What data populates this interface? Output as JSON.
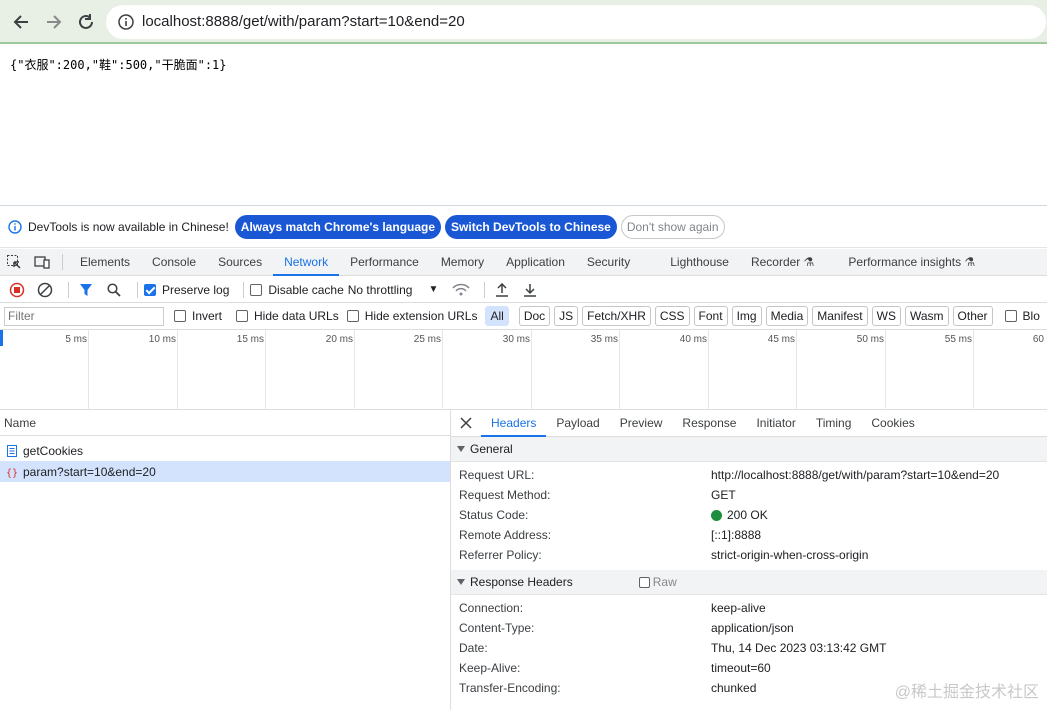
{
  "browser": {
    "url": "localhost:8888/get/with/param?start=10&end=20",
    "icons": [
      "back-arrow-icon",
      "forward-arrow-icon",
      "reload-icon",
      "site-info-icon"
    ]
  },
  "page": {
    "response_text": "{\"衣服\":200,\"鞋\":500,\"干脆面\":1}"
  },
  "infobar": {
    "message": "DevTools is now available in Chinese!",
    "btn_match": "Always match Chrome's language",
    "btn_switch": "Switch DevTools to Chinese",
    "btn_dont_show": "Don't show again"
  },
  "tabs": {
    "elements": "Elements",
    "console": "Console",
    "sources": "Sources",
    "network": "Network",
    "performance": "Performance",
    "memory": "Memory",
    "application": "Application",
    "security": "Security",
    "lighthouse": "Lighthouse",
    "recorder": "Recorder",
    "perf_insights": "Performance insights"
  },
  "toolbar": {
    "preserve_log": "Preserve log",
    "preserve_log_checked": true,
    "disable_cache": "Disable cache",
    "disable_cache_checked": false,
    "throttling": "No throttling"
  },
  "filterbar": {
    "placeholder": "Filter",
    "invert": "Invert",
    "hide_data_urls": "Hide data URLs",
    "hide_ext_urls": "Hide extension URLs",
    "types": [
      "All",
      "Doc",
      "JS",
      "Fetch/XHR",
      "CSS",
      "Font",
      "Img",
      "Media",
      "Manifest",
      "WS",
      "Wasm",
      "Other"
    ],
    "selected_type": "All",
    "blocked_prefix": "Blo"
  },
  "timeline": {
    "ticks": [
      "5 ms",
      "10 ms",
      "15 ms",
      "20 ms",
      "25 ms",
      "30 ms",
      "35 ms",
      "40 ms",
      "45 ms",
      "50 ms",
      "55 ms",
      "60"
    ]
  },
  "requests": {
    "header": "Name",
    "rows": [
      {
        "name": "getCookies",
        "selected": false
      },
      {
        "name": "param?start=10&end=20",
        "selected": true
      }
    ]
  },
  "details": {
    "tabs": [
      "Headers",
      "Payload",
      "Preview",
      "Response",
      "Initiator",
      "Timing",
      "Cookies"
    ],
    "general": {
      "title": "General",
      "rows": [
        {
          "k": "Request URL:",
          "v": "http://localhost:8888/get/with/param?start=10&end=20"
        },
        {
          "k": "Request Method:",
          "v": "GET"
        },
        {
          "k": "Status Code:",
          "v": "200 OK"
        },
        {
          "k": "Remote Address:",
          "v": "[::1]:8888"
        },
        {
          "k": "Referrer Policy:",
          "v": "strict-origin-when-cross-origin"
        }
      ]
    },
    "response_headers": {
      "title": "Response Headers",
      "raw_label": "Raw",
      "rows": [
        {
          "k": "Connection:",
          "v": "keep-alive"
        },
        {
          "k": "Content-Type:",
          "v": "application/json"
        },
        {
          "k": "Date:",
          "v": "Thu, 14 Dec 2023 03:13:42 GMT"
        },
        {
          "k": "Keep-Alive:",
          "v": "timeout=60"
        },
        {
          "k": "Transfer-Encoding:",
          "v": "chunked"
        }
      ]
    }
  },
  "watermark": "@稀土掘金技术社区",
  "colors": {
    "accent": "#1a73e8",
    "status_ok": "#1e8e3e",
    "pill": "#1a57d5"
  }
}
